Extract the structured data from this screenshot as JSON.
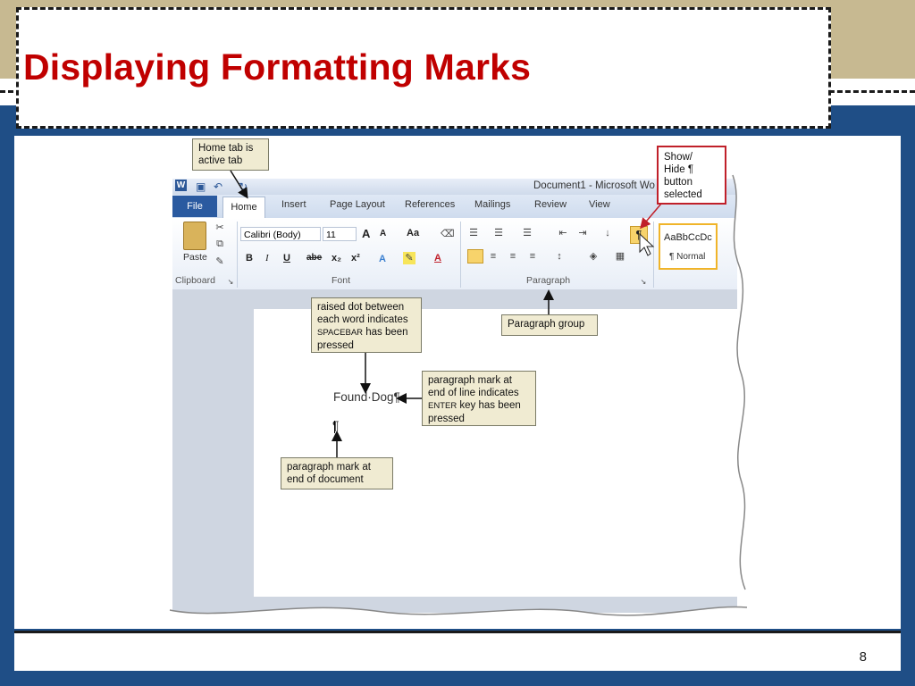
{
  "slide": {
    "title": "Displaying Formatting Marks",
    "page_number": "8"
  },
  "word": {
    "qat": {
      "word_icon": "W",
      "save_icon": "save-icon",
      "undo_icon": "undo-icon",
      "redo_icon": "redo-icon"
    },
    "doc_title": "Document1 - Microsoft Wo",
    "tabs": [
      "File",
      "Home",
      "Insert",
      "Page Layout",
      "References",
      "Mailings",
      "Review",
      "View"
    ],
    "active_tab": "Home",
    "ribbon": {
      "paste_label": "Paste",
      "font_name": "Calibri (Body)",
      "font_size": "11",
      "grow_font": "A",
      "shrink_font": "A",
      "change_case": "Aa",
      "bold": "B",
      "italic": "I",
      "underline": "U",
      "strike": "abe",
      "subscript": "x₂",
      "superscript": "x²",
      "show_hide_glyph": "¶",
      "style_sample": "AaBbCcDc",
      "style_name": "¶ Normal",
      "groups": {
        "clipboard": "Clipboard",
        "font": "Font",
        "paragraph": "Paragraph"
      }
    },
    "document": {
      "line1": "Found·Dog¶",
      "line2": "¶"
    }
  },
  "callouts": {
    "home_tab": [
      "Home tab is",
      "active tab"
    ],
    "show_hide": [
      "Show/",
      "Hide ¶",
      "button",
      "selected"
    ],
    "raised_dot": {
      "line1": "raised dot between",
      "line2": "each word indicates",
      "key": "SPACEBAR",
      "rest": " has been",
      "line4": "pressed"
    },
    "paragraph_group": "Paragraph group",
    "para_mark_line": {
      "line1": "paragraph mark at",
      "line2": "end of line indicates",
      "key": "ENTER",
      "rest": " key has been",
      "line4": "pressed"
    },
    "para_mark_doc": [
      "paragraph mark at",
      "end of document"
    ]
  },
  "colors": {
    "title_red": "#c00000",
    "background_blue": "#1f4e86",
    "band_tan": "#c7b991",
    "callout_fill": "#f0ebd2",
    "highlight_red": "#c0202a"
  }
}
